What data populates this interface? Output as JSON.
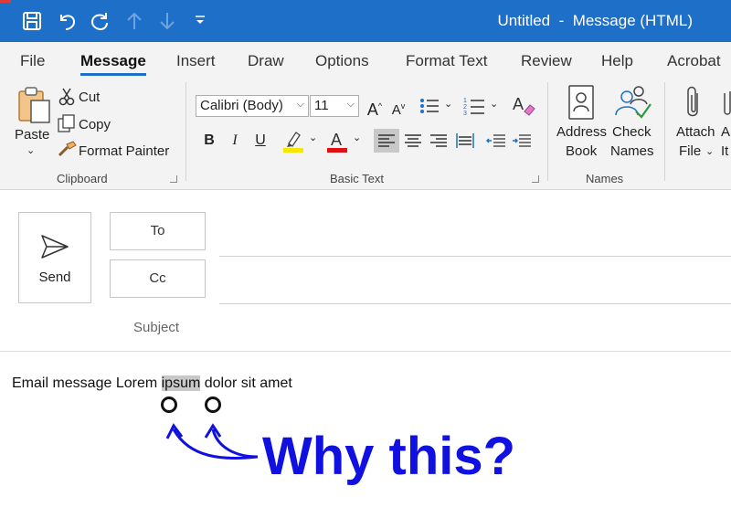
{
  "window": {
    "title": "Untitled  -  Message (HTML)"
  },
  "quick_access": {
    "icons": [
      "save-icon",
      "undo-icon",
      "redo-icon",
      "up-arrow-icon",
      "down-arrow-icon",
      "customize-icon"
    ]
  },
  "tabs": [
    {
      "label": "File"
    },
    {
      "label": "Message",
      "active": true
    },
    {
      "label": "Insert"
    },
    {
      "label": "Draw"
    },
    {
      "label": "Options"
    },
    {
      "label": "Format Text"
    },
    {
      "label": "Review"
    },
    {
      "label": "Help"
    },
    {
      "label": "Acrobat"
    }
  ],
  "ribbon": {
    "clipboard": {
      "paste_label": "Paste",
      "cut_label": "Cut",
      "copy_label": "Copy",
      "format_painter_label": "Format Painter",
      "group_label": "Clipboard"
    },
    "basic_text": {
      "font": "Calibri (Body)",
      "size": "11",
      "group_label": "Basic Text",
      "bold": "B",
      "italic": "I",
      "underline": "U",
      "highlight_color": "#f6e600",
      "font_color": "#e01010"
    },
    "names": {
      "address_book_label_1": "Address",
      "address_book_label_2": "Book",
      "check_names_label_1": "Check",
      "check_names_label_2": "Names",
      "group_label": "Names"
    },
    "include": {
      "attach_label_1": "Attach",
      "attach_label_2": "File",
      "attach_item_label_1": "A",
      "attach_item_label_2": "It"
    }
  },
  "compose": {
    "send_label": "Send",
    "to_label": "To",
    "cc_label": "Cc",
    "subject_label": "Subject",
    "body_before": "Email message Lorem ",
    "body_selected": "ipsum",
    "body_after": " dolor sit amet"
  },
  "annotation": {
    "text": "Why this?",
    "color": "#1010e0"
  },
  "colors": {
    "accent": "#1d6fc7"
  }
}
